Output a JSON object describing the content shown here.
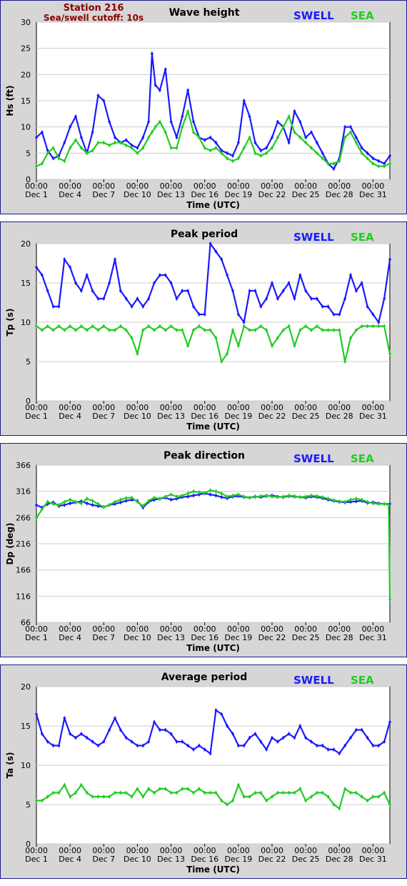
{
  "station": {
    "label": "Station 216",
    "cutoff": "Sea/swell cutoff: 10s"
  },
  "legend": {
    "swell": "SWELL",
    "sea": "SEA"
  },
  "colors": {
    "swell": "#1a1aff",
    "sea": "#22cc22",
    "panel_bg": "#d6d6d6",
    "plot_bg": "#ffffff",
    "grid": "#cccccc",
    "frame": "#1a1a8c"
  },
  "x_axis": {
    "label": "Time (UTC)",
    "tick_time": "00:00",
    "tick_days": [
      "Dec 1",
      "Dec 4",
      "Dec 7",
      "Dec 10",
      "Dec 13",
      "Dec 16",
      "Dec 19",
      "Dec 22",
      "Dec 25",
      "Dec 28",
      "Dec 31"
    ]
  },
  "chart_data": [
    {
      "type": "line",
      "title": "Wave height",
      "ylabel": "Hs (ft)",
      "ylim": [
        0,
        30
      ],
      "yticks": [
        0,
        5,
        10,
        15,
        20,
        25,
        30
      ],
      "x_day_range": [
        1,
        32.5
      ],
      "grid": true,
      "series": [
        {
          "name": "SWELL",
          "x": [
            1,
            1.5,
            2,
            2.5,
            3,
            3.5,
            4,
            4.5,
            5,
            5.5,
            6,
            6.5,
            7,
            7.5,
            8,
            8.5,
            9,
            9.5,
            10,
            10.5,
            11,
            11.3,
            11.6,
            12,
            12.5,
            13,
            13.5,
            14,
            14.5,
            15,
            15.5,
            16,
            16.5,
            17,
            17.5,
            18,
            18.5,
            19,
            19.5,
            20,
            20.5,
            21,
            21.5,
            22,
            22.5,
            23,
            23.5,
            24,
            24.5,
            25,
            25.5,
            26,
            26.5,
            27,
            27.5,
            28,
            28.5,
            29,
            29.5,
            30,
            30.5,
            31,
            31.5,
            32,
            32.5
          ],
          "values": [
            8,
            9,
            5.5,
            4,
            4.5,
            7,
            10,
            12,
            8,
            5,
            9,
            16,
            15,
            11,
            8,
            7,
            7.5,
            6.5,
            6,
            8,
            11,
            24,
            18,
            17,
            21,
            11,
            8,
            12,
            17,
            11,
            8,
            7.5,
            8,
            7,
            5.5,
            5,
            4.5,
            7,
            15,
            12,
            7,
            5.5,
            6,
            8,
            11,
            10,
            7,
            13,
            11,
            8,
            9,
            7,
            5,
            3,
            2,
            4,
            10,
            10,
            8,
            6,
            5,
            4,
            3.5,
            3,
            4.5
          ]
        },
        {
          "name": "SEA",
          "x": [
            1,
            1.5,
            2,
            2.5,
            3,
            3.5,
            4,
            4.5,
            5,
            5.5,
            6,
            6.5,
            7,
            7.5,
            8,
            8.5,
            9,
            9.5,
            10,
            10.5,
            11,
            11.3,
            11.6,
            12,
            12.5,
            13,
            13.5,
            14,
            14.5,
            15,
            15.5,
            16,
            16.5,
            17,
            17.5,
            18,
            18.5,
            19,
            19.5,
            20,
            20.5,
            21,
            21.5,
            22,
            22.5,
            23,
            23.5,
            24,
            24.5,
            25,
            25.5,
            26,
            26.5,
            27,
            27.5,
            28,
            28.5,
            29,
            29.5,
            30,
            30.5,
            31,
            31.5,
            32,
            32.5
          ],
          "values": [
            2.5,
            3,
            5,
            6,
            4,
            3.5,
            6,
            7.5,
            6,
            5,
            5.5,
            7,
            7,
            6.5,
            7,
            7,
            6.5,
            6,
            5,
            6,
            8,
            9,
            10,
            11,
            9,
            6,
            6,
            10,
            13,
            9,
            8,
            6,
            5.5,
            6,
            5,
            4,
            3.5,
            4,
            6,
            8,
            5,
            4.5,
            5,
            6,
            8,
            10,
            12,
            9,
            8,
            7,
            6,
            5,
            4,
            3,
            3,
            3.5,
            8,
            9,
            7,
            5,
            4,
            3,
            2.5,
            2.5,
            3
          ]
        }
      ]
    },
    {
      "type": "line",
      "title": "Peak period",
      "ylabel": "Tp (s)",
      "ylim": [
        0,
        20
      ],
      "yticks": [
        0,
        5,
        10,
        15,
        20
      ],
      "x_day_range": [
        1,
        32.5
      ],
      "grid": true,
      "series": [
        {
          "name": "SWELL",
          "x": [
            1,
            1.5,
            2,
            2.5,
            3,
            3.5,
            4,
            4.5,
            5,
            5.5,
            6,
            6.5,
            7,
            7.5,
            8,
            8.5,
            9,
            9.5,
            10,
            10.5,
            11,
            11.5,
            12,
            12.5,
            13,
            13.5,
            14,
            14.5,
            15,
            15.5,
            16,
            16.5,
            17,
            17.5,
            18,
            18.5,
            19,
            19.5,
            20,
            20.5,
            21,
            21.5,
            22,
            22.5,
            23,
            23.5,
            24,
            24.5,
            25,
            25.5,
            26,
            26.5,
            27,
            27.5,
            28,
            28.5,
            29,
            29.5,
            30,
            30.5,
            31,
            31.5,
            32,
            32.5
          ],
          "values": [
            17,
            16,
            14,
            12,
            12,
            18,
            17,
            15,
            14,
            16,
            14,
            13,
            13,
            15,
            18,
            14,
            13,
            12,
            13,
            12,
            13,
            15,
            16,
            16,
            15,
            13,
            14,
            14,
            12,
            11,
            11,
            20,
            19,
            18,
            16,
            14,
            11,
            10,
            14,
            14,
            12,
            13,
            15,
            13,
            14,
            15,
            13,
            16,
            14,
            13,
            13,
            12,
            12,
            11,
            11,
            13,
            16,
            14,
            15,
            12,
            11,
            10,
            13,
            18
          ]
        },
        {
          "name": "SEA",
          "x": [
            1,
            1.5,
            2,
            2.5,
            3,
            3.5,
            4,
            4.5,
            5,
            5.5,
            6,
            6.5,
            7,
            7.5,
            8,
            8.5,
            9,
            9.5,
            10,
            10.5,
            11,
            11.5,
            12,
            12.5,
            13,
            13.5,
            14,
            14.5,
            15,
            15.5,
            16,
            16.5,
            17,
            17.5,
            18,
            18.5,
            19,
            19.5,
            20,
            20.5,
            21,
            21.5,
            22,
            22.5,
            23,
            23.5,
            24,
            24.5,
            25,
            25.5,
            26,
            26.5,
            27,
            27.5,
            28,
            28.5,
            29,
            29.5,
            30,
            30.5,
            31,
            31.5,
            32,
            32.5
          ],
          "values": [
            9.5,
            9,
            9.5,
            9,
            9.5,
            9,
            9.5,
            9,
            9.5,
            9,
            9.5,
            9,
            9.5,
            9,
            9,
            9.5,
            9,
            8,
            6,
            9,
            9.5,
            9,
            9.5,
            9,
            9.5,
            9,
            9,
            7,
            9,
            9.5,
            9,
            9,
            8,
            5,
            6,
            9,
            7,
            9.5,
            9,
            9,
            9.5,
            9,
            7,
            8,
            9,
            9.5,
            7,
            9,
            9.5,
            9,
            9.5,
            9,
            9,
            9,
            9,
            5,
            8,
            9,
            9.5,
            9.5,
            9.5,
            9.5,
            9.5,
            6
          ]
        }
      ]
    },
    {
      "type": "line",
      "title": "Peak direction",
      "ylabel": "Dp (deg)",
      "ylim": [
        66,
        366
      ],
      "yticks": [
        66,
        116,
        166,
        216,
        266,
        316,
        366
      ],
      "x_day_range": [
        1,
        32.5
      ],
      "grid": true,
      "series": [
        {
          "name": "SWELL",
          "x": [
            1,
            1.5,
            2,
            2.5,
            3,
            3.5,
            4,
            4.5,
            5,
            5.5,
            6,
            6.5,
            7,
            7.5,
            8,
            8.5,
            9,
            9.5,
            10,
            10.5,
            11,
            11.5,
            12,
            12.5,
            13,
            13.5,
            14,
            14.5,
            15,
            15.5,
            16,
            16.5,
            17,
            17.5,
            18,
            18.5,
            19,
            19.5,
            20,
            20.5,
            21,
            21.5,
            22,
            22.5,
            23,
            23.5,
            24,
            24.5,
            25,
            25.5,
            26,
            26.5,
            27,
            27.5,
            28,
            28.5,
            29,
            29.5,
            30,
            30.5,
            31,
            31.5,
            32,
            32.5
          ],
          "values": [
            290,
            285,
            292,
            295,
            288,
            290,
            293,
            295,
            297,
            293,
            290,
            288,
            286,
            290,
            292,
            295,
            298,
            300,
            298,
            285,
            296,
            300,
            302,
            304,
            300,
            302,
            305,
            306,
            308,
            310,
            312,
            310,
            308,
            305,
            303,
            306,
            307,
            305,
            304,
            306,
            305,
            307,
            308,
            306,
            305,
            307,
            306,
            305,
            304,
            306,
            305,
            303,
            300,
            298,
            296,
            295,
            296,
            297,
            298,
            294,
            295,
            293,
            292,
            292
          ]
        },
        {
          "name": "SEA",
          "x": [
            1,
            1.5,
            2,
            2.5,
            3,
            3.5,
            4,
            4.5,
            5,
            5.5,
            6,
            6.5,
            7,
            7.5,
            8,
            8.5,
            9,
            9.5,
            10,
            10.5,
            11,
            11.5,
            12,
            12.5,
            13,
            13.5,
            14,
            14.5,
            15,
            15.5,
            16,
            16.5,
            17,
            17.5,
            18,
            18.5,
            19,
            19.5,
            20,
            20.5,
            21,
            21.5,
            22,
            22.5,
            23,
            23.5,
            24,
            24.5,
            25,
            25.5,
            26,
            26.5,
            27,
            27.5,
            28,
            28.5,
            29,
            29.5,
            30,
            30.5,
            31,
            31.5,
            32,
            32.4,
            32.5
          ],
          "values": [
            265,
            282,
            296,
            292,
            290,
            296,
            300,
            296,
            293,
            302,
            298,
            292,
            286,
            290,
            296,
            300,
            303,
            304,
            296,
            288,
            298,
            304,
            302,
            306,
            310,
            306,
            308,
            312,
            316,
            314,
            313,
            318,
            316,
            312,
            306,
            308,
            310,
            306,
            304,
            305,
            307,
            308,
            306,
            305,
            306,
            308,
            307,
            305,
            306,
            308,
            307,
            305,
            302,
            299,
            297,
            296,
            300,
            302,
            300,
            296,
            293,
            292,
            292,
            290,
            110
          ]
        }
      ]
    },
    {
      "type": "line",
      "title": "Average period",
      "ylabel": "Ta (s)",
      "ylim": [
        0,
        20
      ],
      "yticks": [
        0,
        5,
        10,
        15,
        20
      ],
      "x_day_range": [
        1,
        32.5
      ],
      "grid": true,
      "series": [
        {
          "name": "SWELL",
          "x": [
            1,
            1.5,
            2,
            2.5,
            3,
            3.5,
            4,
            4.5,
            5,
            5.5,
            6,
            6.5,
            7,
            7.5,
            8,
            8.5,
            9,
            9.5,
            10,
            10.5,
            11,
            11.5,
            12,
            12.5,
            13,
            13.5,
            14,
            14.5,
            15,
            15.5,
            16,
            16.5,
            17,
            17.5,
            18,
            18.5,
            19,
            19.5,
            20,
            20.5,
            21,
            21.5,
            22,
            22.5,
            23,
            23.5,
            24,
            24.5,
            25,
            25.5,
            26,
            26.5,
            27,
            27.5,
            28,
            28.5,
            29,
            29.5,
            30,
            30.5,
            31,
            31.5,
            32,
            32.5
          ],
          "values": [
            16.5,
            14,
            13,
            12.5,
            12.5,
            16,
            14,
            13.5,
            14,
            13.5,
            13,
            12.5,
            13,
            14.5,
            16,
            14.5,
            13.5,
            13,
            12.5,
            12.5,
            13,
            15.5,
            14.5,
            14.5,
            14,
            13,
            13,
            12.5,
            12,
            12.5,
            12,
            11.5,
            17,
            16.5,
            15,
            14,
            12.5,
            12.5,
            13.5,
            14,
            13,
            12,
            13.5,
            13,
            13.5,
            14,
            13.5,
            15,
            13.5,
            13,
            12.5,
            12.5,
            12,
            12,
            11.5,
            12.5,
            13.5,
            14.5,
            14.5,
            13.5,
            12.5,
            12.5,
            13,
            15.5
          ]
        },
        {
          "name": "SEA",
          "x": [
            1,
            1.5,
            2,
            2.5,
            3,
            3.5,
            4,
            4.5,
            5,
            5.5,
            6,
            6.5,
            7,
            7.5,
            8,
            8.5,
            9,
            9.5,
            10,
            10.5,
            11,
            11.5,
            12,
            12.5,
            13,
            13.5,
            14,
            14.5,
            15,
            15.5,
            16,
            16.5,
            17,
            17.5,
            18,
            18.5,
            19,
            19.5,
            20,
            20.5,
            21,
            21.5,
            22,
            22.5,
            23,
            23.5,
            24,
            24.5,
            25,
            25.5,
            26,
            26.5,
            27,
            27.5,
            28,
            28.5,
            29,
            29.5,
            30,
            30.5,
            31,
            31.5,
            32,
            32.5
          ],
          "values": [
            5.5,
            5.5,
            6,
            6.5,
            6.5,
            7.5,
            6,
            6.5,
            7.5,
            6.5,
            6,
            6,
            6,
            6,
            6.5,
            6.5,
            6.5,
            6,
            7,
            6,
            7,
            6.5,
            7,
            7,
            6.5,
            6.5,
            7,
            7,
            6.5,
            7,
            6.5,
            6.5,
            6.5,
            5.5,
            5,
            5.5,
            7.5,
            6,
            6,
            6.5,
            6.5,
            5.5,
            6,
            6.5,
            6.5,
            6.5,
            6.5,
            7,
            5.5,
            6,
            6.5,
            6.5,
            6,
            5,
            4.5,
            7,
            6.5,
            6.5,
            6,
            5.5,
            6,
            6,
            6.5,
            5
          ]
        }
      ]
    }
  ]
}
